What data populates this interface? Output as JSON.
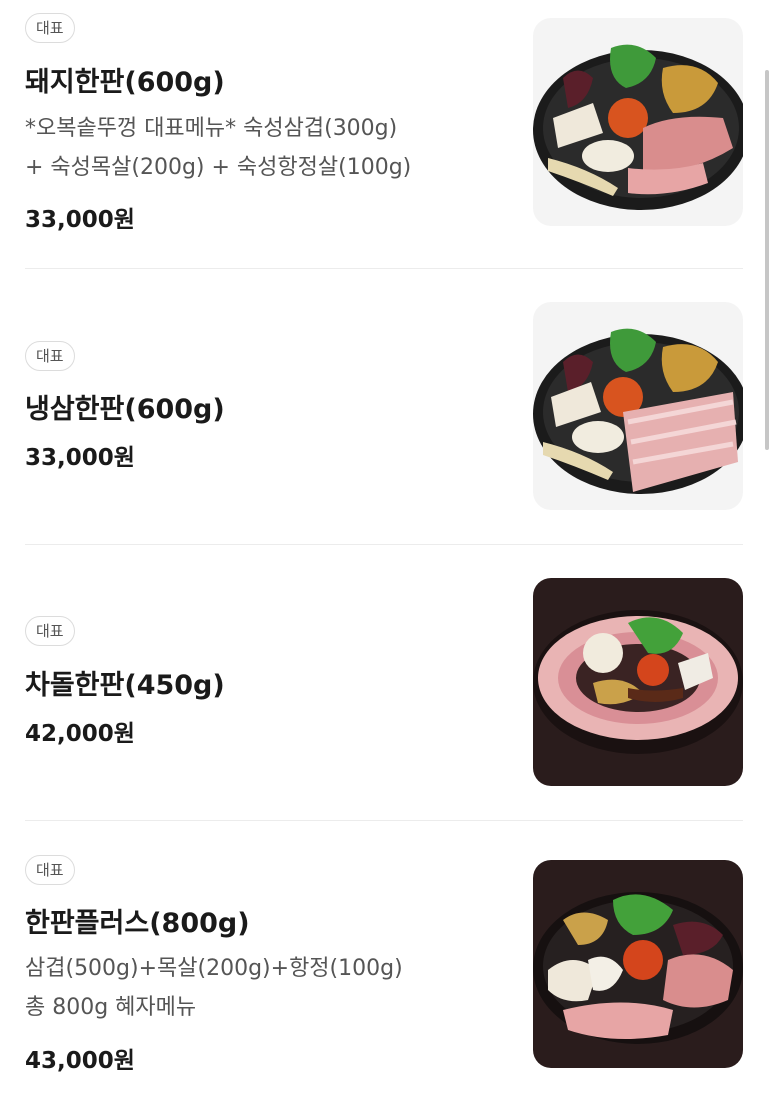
{
  "menu": {
    "items": [
      {
        "badge": "대표",
        "name": "돼지한판(600g)",
        "desc_line1": "*오복솥뚜껑 대표메뉴* 숙성삼겹(300g)",
        "desc_line2": "+ 숙성목살(200g) + 숙성항정살(100g)",
        "price": "33,000원"
      },
      {
        "badge": "대표",
        "name": "냉삼한판(600g)",
        "price": "33,000원"
      },
      {
        "badge": "대표",
        "name": "차돌한판(450g)",
        "price": "42,000원"
      },
      {
        "badge": "대표",
        "name": "한판플러스(800g)",
        "desc_line1": "삼겹(500g)+목살(200g)+항정(100g)",
        "desc_line2": "총 800g 혜자메뉴",
        "price": "43,000원"
      }
    ]
  },
  "colors": {
    "badge_border": "#dcdcdc",
    "divider": "#ececec",
    "price": "#1a1a1a",
    "desc": "#555555"
  }
}
